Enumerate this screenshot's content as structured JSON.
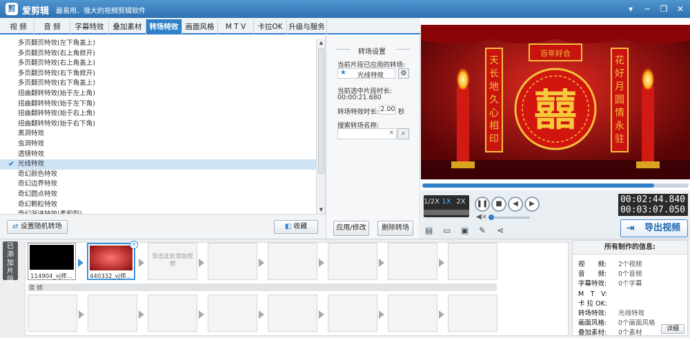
{
  "app": {
    "name": "爱剪辑",
    "slogan": "最易用、强大的视频剪辑软件"
  },
  "tabs": [
    "视 频",
    "音 频",
    "字幕特效",
    "叠加素材",
    "转场特效",
    "画面风格",
    "M T V",
    "卡拉OK",
    "升级与服务"
  ],
  "transitions": [
    "多页翻页特效(左下角盖上)",
    "多页翻页特效(右上角掀开)",
    "多页翻页特效(右上角盖上)",
    "多页翻页特效(右下角掀开)",
    "多页翻页特效(右下角盖上)",
    "扭曲翻转特效(始于左上角)",
    "扭曲翻转特效(始于左下角)",
    "扭曲翻转特效(始于右上角)",
    "扭曲翻转特效(始于右下角)",
    "黑洞特效",
    "虫洞特效",
    "透镜特效",
    "光线特效",
    "奇幻颜色特效",
    "奇幻边界特效",
    "奇幻圆点特效",
    "奇幻颗粒特效",
    "奇幻渐进特效(柔和型)"
  ],
  "selected_index": 12,
  "bottom_left": {
    "random": "设置随机转场",
    "collect": "收藏"
  },
  "settings": {
    "title": "转场设置",
    "applied_label": "当前片段已应用的转场:",
    "applied_value": "光线特效",
    "duration_label": "当前选中片段时长:",
    "duration_value": "00:00:21.680",
    "effect_duration_label": "转场特效时长:",
    "effect_duration_value": "2.00",
    "effect_duration_unit": "秒",
    "search_label": "搜索转场名称:",
    "search_value": "",
    "apply_btn": "应用/修改",
    "delete_btn": "删除转场"
  },
  "preview": {
    "banner": "百年好合",
    "left_couplet": "天长地久心相印",
    "right_couplet": "花好月圆情永驻",
    "center_char": "囍"
  },
  "player": {
    "progress": 0.87,
    "speeds": [
      "1/2X",
      "1X",
      "2X"
    ],
    "current_time": "00:02:44.840",
    "total_time": "00:03:07.050",
    "export_label": "导出视频"
  },
  "timeline": {
    "side_label": "已添加片段",
    "clips": [
      {
        "name": "114904_vj师..."
      },
      {
        "name": "440332_vj师..."
      }
    ],
    "add_hint": "双击此处添加视频",
    "audio_label": "音 频"
  },
  "info": {
    "title": "所有制作的信息:",
    "rows": [
      {
        "k": "视　　频:",
        "v": "2个视频"
      },
      {
        "k": "音　　频:",
        "v": "0个音频"
      },
      {
        "k": "字幕特效:",
        "v": "0个字幕"
      },
      {
        "k": "M　T　V:",
        "v": ""
      },
      {
        "k": "卡 拉 OK:",
        "v": ""
      },
      {
        "k": "转场特效:",
        "v": "光线特效"
      },
      {
        "k": "画面风格:",
        "v": "0个画面风格"
      },
      {
        "k": "叠加素材:",
        "v": "0个素材"
      }
    ],
    "detail": "详细"
  },
  "colors": {
    "accent": "#2f80c8",
    "titlebar": "#3b7fc0",
    "stage": "#b10d10",
    "gold": "#f3c23c"
  }
}
